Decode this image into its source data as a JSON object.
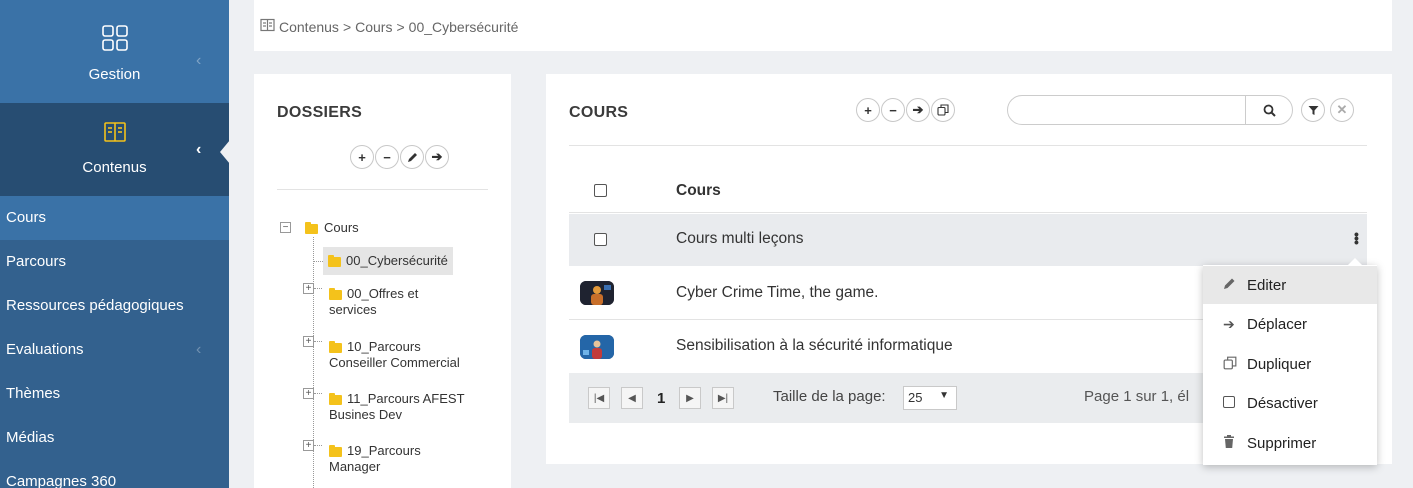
{
  "sidebar": {
    "gestion_label": "Gestion",
    "contenus_label": "Contenus",
    "items": [
      {
        "label": "Cours"
      },
      {
        "label": "Parcours"
      },
      {
        "label": "Ressources pédagogiques"
      },
      {
        "label": "Evaluations"
      },
      {
        "label": "Thèmes"
      },
      {
        "label": "Médias"
      },
      {
        "label": "Campagnes 360"
      }
    ]
  },
  "breadcrumb": {
    "items": [
      "Contenus",
      "Cours",
      "00_Cybersécurité"
    ],
    "separator": ">"
  },
  "folders": {
    "title": "DOSSIERS",
    "tree": {
      "root": "Cours",
      "children": [
        {
          "label": "00_Cybersécurité"
        },
        {
          "label_line1": "00_Offres et",
          "label_line2": "services"
        },
        {
          "label_line1": "10_Parcours",
          "label_line2": "Conseiller Commercial"
        },
        {
          "label_line1": "11_Parcours AFEST",
          "label_line2": "Busines Dev"
        },
        {
          "label_line1": "19_Parcours",
          "label_line2": "Manager"
        }
      ]
    }
  },
  "courses": {
    "title": "COURS",
    "search_value": "",
    "column_header": "Cours",
    "rows": [
      {
        "title": "Cours multi leçons"
      },
      {
        "title": "Cyber Crime Time, the game."
      },
      {
        "title": "Sensibilisation à la sécurité informatique"
      }
    ],
    "pager": {
      "current_page": "1",
      "page_size_label": "Taille de la page:",
      "page_size": "25",
      "info": "Page 1 sur 1, él"
    }
  },
  "context_menu": {
    "items": [
      {
        "label": "Editer",
        "icon": "pencil-icon"
      },
      {
        "label": "Déplacer",
        "icon": "arrow-right-icon"
      },
      {
        "label": "Dupliquer",
        "icon": "duplicate-icon"
      },
      {
        "label": "Désactiver",
        "icon": "checkbox-icon"
      },
      {
        "label": "Supprimer",
        "icon": "trash-icon"
      }
    ]
  },
  "colors": {
    "sidebar": "#33618e",
    "sidebar_active": "#3a72a7",
    "folder": "#f4c21b"
  }
}
